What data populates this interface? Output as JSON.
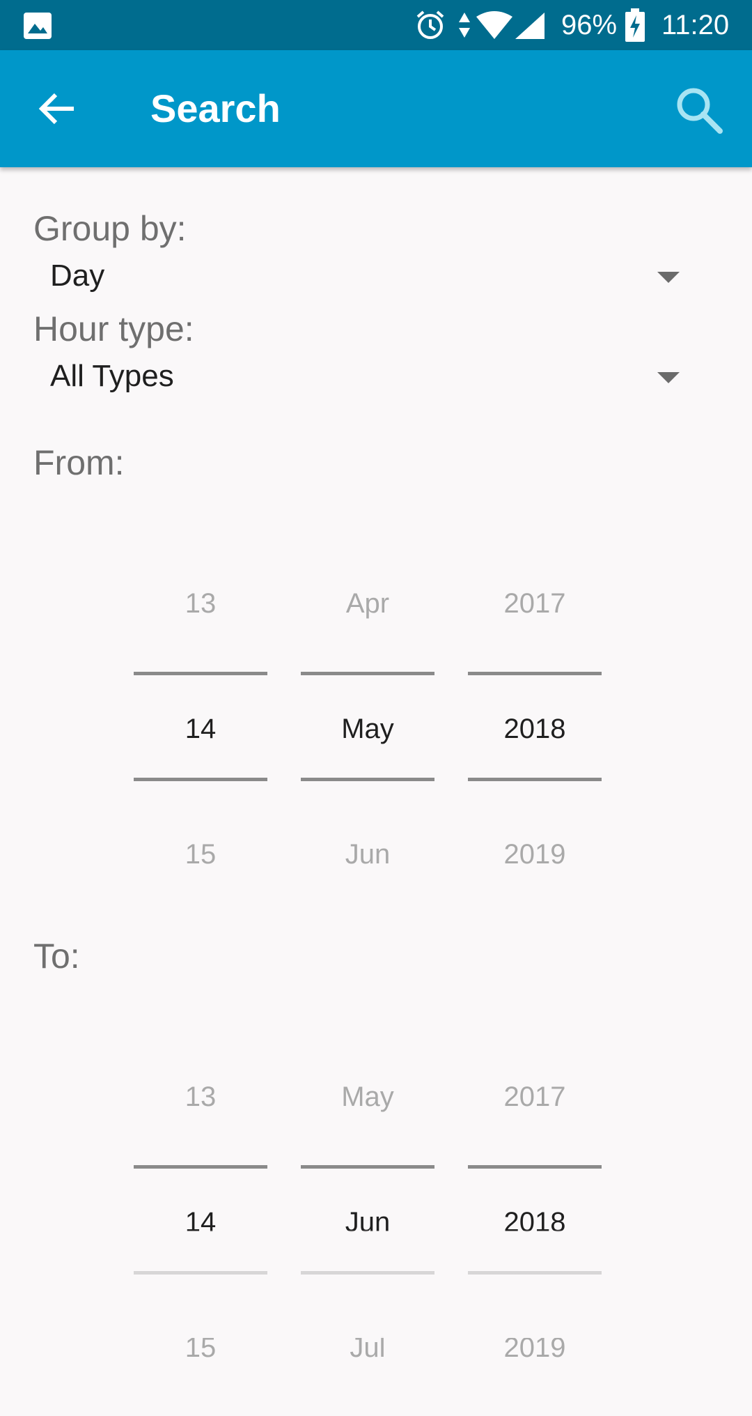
{
  "status_bar": {
    "battery": "96%",
    "time": "11:20",
    "icons": [
      "gallery-icon",
      "alarm-icon",
      "data-transfer-icon",
      "wifi-icon",
      "signal-icon",
      "battery-charging-icon"
    ]
  },
  "app_bar": {
    "title": "Search",
    "back_icon": "arrow-back-icon",
    "search_icon": "search-icon",
    "color": "#0097c9"
  },
  "form": {
    "group_by": {
      "label": "Group by:",
      "value": "Day"
    },
    "hour_type": {
      "label": "Hour type:",
      "value": "All Types"
    },
    "from": {
      "label": "From:",
      "day": {
        "prev": "13",
        "current": "14",
        "next": "15"
      },
      "month": {
        "prev": "Apr",
        "current": "May",
        "next": "Jun"
      },
      "year": {
        "prev": "2017",
        "current": "2018",
        "next": "2019"
      }
    },
    "to": {
      "label": "To:",
      "day": {
        "prev": "13",
        "current": "14",
        "next": "15"
      },
      "month": {
        "prev": "May",
        "current": "Jun",
        "next": "Jul"
      },
      "year": {
        "prev": "2017",
        "current": "2018",
        "next": "2019"
      }
    }
  }
}
